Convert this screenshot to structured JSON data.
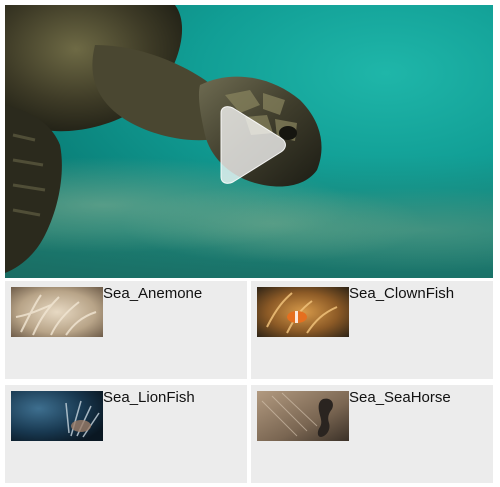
{
  "player": {
    "play_icon": "play-icon",
    "water_color": "#119e95"
  },
  "videos": [
    {
      "title": "Sea_Anemone"
    },
    {
      "title": "Sea_ClownFish"
    },
    {
      "title": "Sea_LionFish"
    },
    {
      "title": "Sea_SeaHorse"
    }
  ],
  "colors": {
    "card_background": "#ececec",
    "text": "#111111"
  }
}
